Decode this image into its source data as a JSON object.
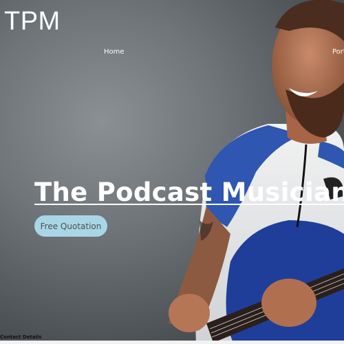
{
  "brand": {
    "logo_text": "TPM"
  },
  "nav": {
    "items": [
      {
        "label": "Home"
      },
      {
        "label": "Port"
      }
    ]
  },
  "hero": {
    "headline": "The Podcast Musician",
    "cta_label": "Free Quotation",
    "cta_color": "#a9d6e6"
  },
  "footer": {
    "contact_label": "Contact Details"
  }
}
